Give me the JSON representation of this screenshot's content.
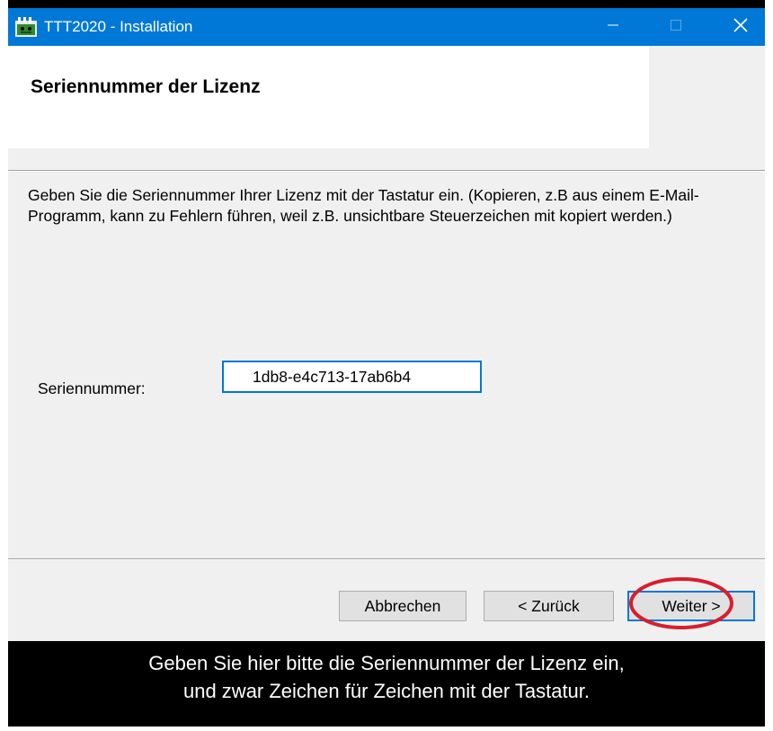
{
  "window": {
    "title": "TTT2020 - Installation",
    "title_bar_color": "#0078d7",
    "icons": {
      "app": "app-icon",
      "minimize": "minimize-icon",
      "maximize": "maximize-icon",
      "close": "close-icon"
    }
  },
  "header": {
    "title": "Seriennummer der Lizenz"
  },
  "content": {
    "instructions": "Geben Sie die Seriennummer Ihrer Lizenz mit der Tastatur ein. (Kopieren, z.B aus einem E-Mail-Programm, kann zu Fehlern führen, weil z.B. unsichtbare Steuerzeichen mit kopiert werden.)",
    "serial_label": "Seriennummer:",
    "serial_value": "1db8-e4c713-17ab6b4"
  },
  "buttons": {
    "cancel": "Abbrechen",
    "back": "< Zurück",
    "next": "Weiter >"
  },
  "caption": {
    "line1": "Geben Sie hier bitte die Seriennummer der Lizenz ein,",
    "line2": "und zwar Zeichen für Zeichen mit der Tastatur."
  },
  "colors": {
    "highlight_ellipse": "#d81e2c",
    "focus_border": "#0078d7"
  }
}
